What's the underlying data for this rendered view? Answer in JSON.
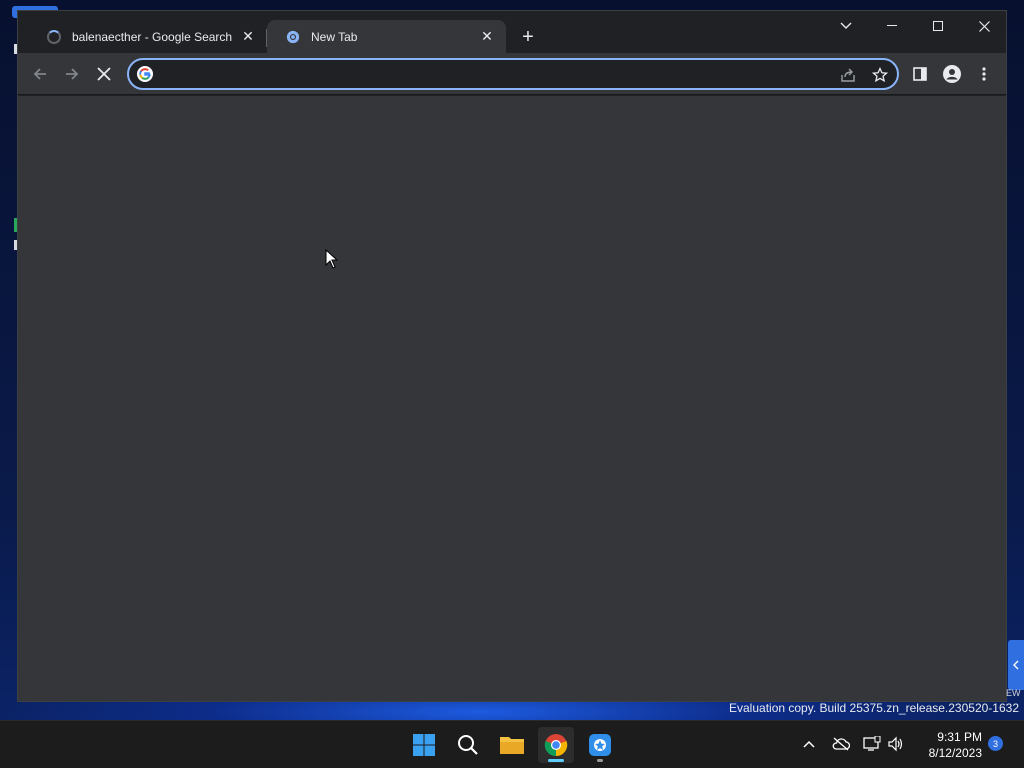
{
  "browser": {
    "tabs": [
      {
        "title": "balenaecther - Google Search",
        "state": "loading",
        "active": false,
        "close_glyph": "✕"
      },
      {
        "title": "New Tab",
        "state": "idle",
        "active": true,
        "close_glyph": "✕"
      }
    ],
    "new_tab_glyph": "+",
    "window_controls": {
      "tab_search_glyph": "⌄",
      "minimize_glyph": "—",
      "maximize_glyph": "☐",
      "close_glyph": "✕"
    },
    "omnibox": {
      "value": "",
      "placeholder": ""
    },
    "accent_color": "#8ab4f8"
  },
  "desktop": {
    "watermark": "Evaluation copy. Build 25375.zn_release.230520-1632",
    "side_fragment": "EW"
  },
  "taskbar": {
    "clock_time": "9:31 PM",
    "clock_date": "8/12/2023",
    "notification_count": "3",
    "tray_chevron": "^"
  }
}
